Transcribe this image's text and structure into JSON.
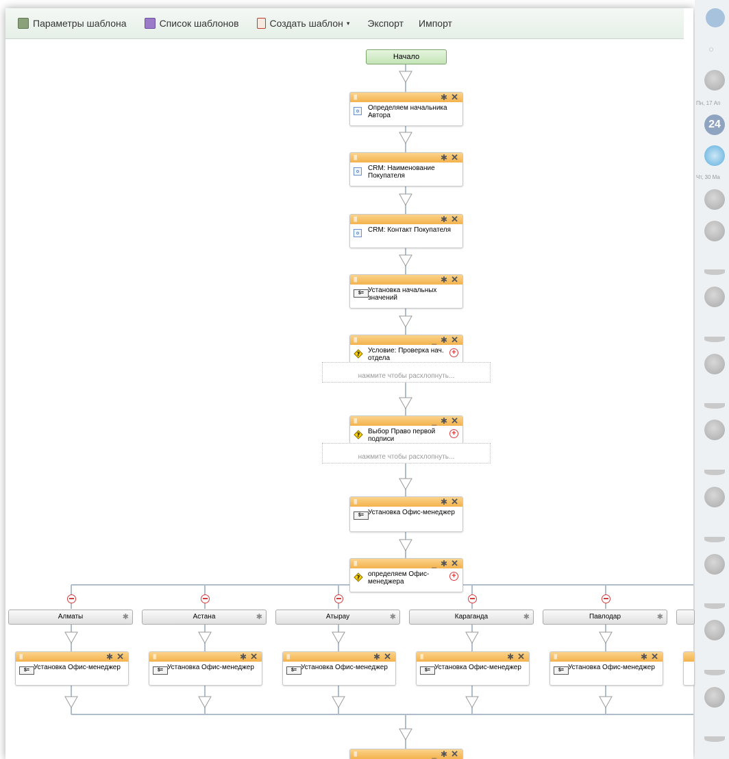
{
  "toolbar": {
    "params_label": "Параметры шаблона",
    "list_label": "Список шаблонов",
    "create_label": "Создать шаблон",
    "export_label": "Экспорт",
    "import_label": "Импорт"
  },
  "rightbar": {
    "badge_count": "24",
    "date1": "Пн, 17 Ап",
    "date2": "Чт, 30 Ма"
  },
  "workflow": {
    "start_label": "Начало",
    "collapsed_hint": "нажмите чтобы расхлопнуть...",
    "activity_1": "Определяем начальника Автора",
    "activity_2": "CRM: Наименование Покупателя",
    "activity_3": "CRM: Контакт Покупателя",
    "activity_4": "Установка начальных значений",
    "condition_1": "Условие: Проверка нач. отдела",
    "condition_2": "Выбор Право первой подписи",
    "activity_5": "Установка Офис-менеджер",
    "condition_3": "определяем Офис-менеджера",
    "branches": [
      "Алматы",
      "Астана",
      "Атырау",
      "Караганда",
      "Павлодар"
    ],
    "branch_activity": "Установка Офис-менеджер"
  },
  "colors": {
    "header_orange": "#f4b24d",
    "start_green": "#c3e4b6",
    "line_blue": "#aebccc"
  }
}
